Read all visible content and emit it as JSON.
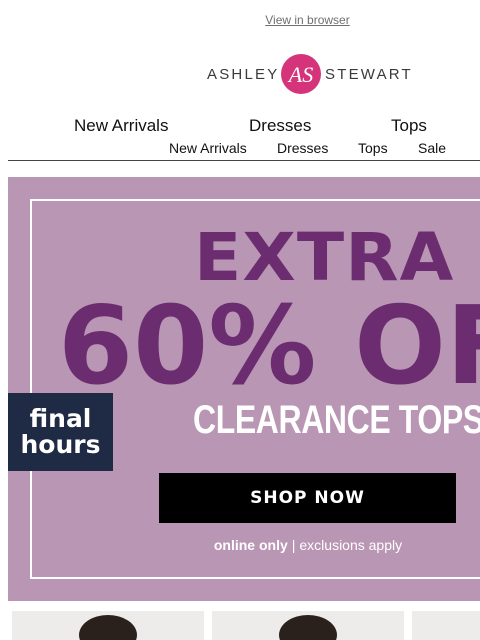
{
  "header": {
    "view_in_browser": "View in browser"
  },
  "logo": {
    "left_word": "ASHLEY",
    "right_word": "STEWART",
    "monogram": "AS",
    "brand_color": "#d5347b"
  },
  "nav_primary": {
    "items": [
      "New Arrivals",
      "Dresses",
      "Tops"
    ]
  },
  "nav_secondary": {
    "items": [
      "New Arrivals",
      "Dresses",
      "Tops",
      "Sale"
    ]
  },
  "hero": {
    "headline_top": "EXTRA",
    "headline_main": "60% OF",
    "subheadline": "CLEARANCE TOPS",
    "badge_line1": "final",
    "badge_line2": "hours",
    "cta": "SHOP NOW",
    "fine_print_left": "online only",
    "fine_print_sep": "|",
    "fine_print_right": "exclusions apply",
    "colors": {
      "background": "#b896b4",
      "headline": "#6b2d70",
      "badge": "#1f2a44",
      "cta": "#000000"
    }
  },
  "products": {
    "count_visible": 3
  }
}
